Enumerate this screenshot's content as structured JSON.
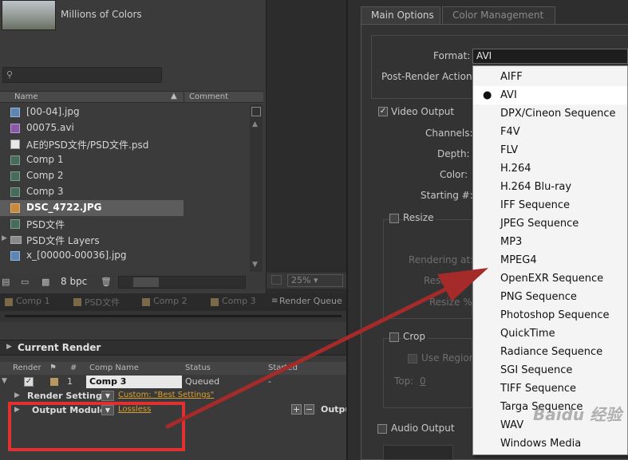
{
  "project": {
    "color_depth_text": "Millions of Colors",
    "search_placeholder": "",
    "columns": {
      "name": "Name",
      "comment": "Comment"
    },
    "items": [
      {
        "label": "[00-04].jpg",
        "icon": "image-sequence-icon"
      },
      {
        "label": "00075.avi",
        "icon": "video-file-icon"
      },
      {
        "label": "AE的PSD文件/PSD文件.psd",
        "icon": "psd-file-icon"
      },
      {
        "label": "Comp 1",
        "icon": "composition-icon"
      },
      {
        "label": "Comp 2",
        "icon": "composition-icon"
      },
      {
        "label": "Comp 3",
        "icon": "composition-icon"
      },
      {
        "label": "DSC_4722.JPG",
        "icon": "jpg-file-icon",
        "selected": true
      },
      {
        "label": "PSD文件",
        "icon": "composition-icon"
      },
      {
        "label": "PSD文件 Layers",
        "icon": "folder-icon"
      },
      {
        "label": "x_[00000-00036].jpg",
        "icon": "image-sequence-icon"
      }
    ],
    "bpc": "8 bpc"
  },
  "viewer": {
    "zoom": "25%"
  },
  "tabs": [
    "Comp 1",
    "PSD文件",
    "Comp 2",
    "Comp 3",
    "Render Queue"
  ],
  "render_queue": {
    "current_render": "Current Render",
    "columns": {
      "render": "Render",
      "num": "#",
      "comp_name": "Comp Name",
      "status": "Status",
      "started": "Started"
    },
    "item": {
      "num": "1",
      "comp": "Comp 3",
      "status": "Queued",
      "started": "-"
    },
    "render_settings": {
      "label": "Render Settings:",
      "value": "Custom: \"Best Settings\""
    },
    "output_module": {
      "label": "Output Module:",
      "value": "Lossless",
      "output_label": "Output"
    }
  },
  "dialog": {
    "tabs": [
      "Main Options",
      "Color Management"
    ],
    "format_label": "Format:",
    "format_value": "AVI",
    "post_render_label": "Post-Render Action:",
    "video_output_label": "Video Output",
    "channels_label": "Channels:",
    "depth_label": "Depth:",
    "color_label": "Color:",
    "starting_label": "Starting #:",
    "resize_label": "Resize",
    "rendering_at_label": "Rendering at:",
    "resize_to_label": "Resize to:",
    "resize_pct_label": "Resize %:",
    "crop_label": "Crop",
    "use_region_label": "Use Region",
    "top_label": "Top:",
    "top_value": "0",
    "audio_output_label": "Audio Output"
  },
  "format_menu": {
    "selected": "AVI",
    "options": [
      "AIFF",
      "AVI",
      "DPX/Cineon Sequence",
      "F4V",
      "FLV",
      "H.264",
      "H.264 Blu-ray",
      "IFF Sequence",
      "JPEG Sequence",
      "MP3",
      "MPEG4",
      "OpenEXR Sequence",
      "PNG Sequence",
      "Photoshop Sequence",
      "QuickTime",
      "Radiance Sequence",
      "SGI Sequence",
      "TIFF Sequence",
      "Targa Sequence",
      "WAV",
      "Windows Media"
    ]
  },
  "annotation": {
    "arrow_color": "#a52a2a",
    "box_color": "#e03030"
  },
  "watermark": "Baidu 经验"
}
